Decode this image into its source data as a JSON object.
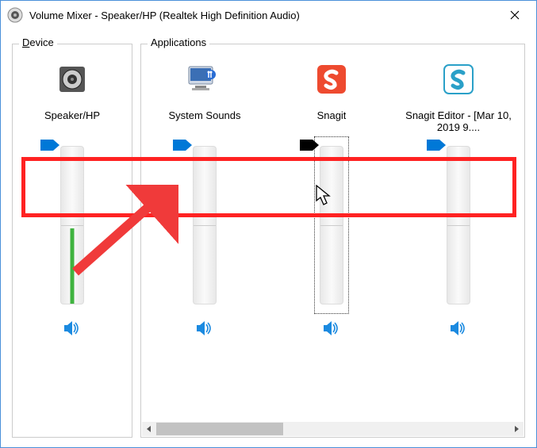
{
  "window": {
    "title": "Volume Mixer - Speaker/HP (Realtek High Definition Audio)"
  },
  "sections": {
    "device": "Device",
    "applications": "Applications"
  },
  "device": {
    "name": "Speaker/HP",
    "icon": "speaker-device-icon",
    "thumb": "blue",
    "level_pct": 48,
    "muted": false
  },
  "apps": [
    {
      "name": "System Sounds",
      "icon": "system-sounds-icon",
      "thumb": "blue",
      "focused": false,
      "muted": false
    },
    {
      "name": "Snagit",
      "icon": "snagit-icon",
      "thumb": "black",
      "focused": true,
      "muted": false
    },
    {
      "name": "Snagit Editor - [Mar 10, 2019 9....",
      "icon": "snagit-editor-icon",
      "thumb": "blue",
      "focused": false,
      "muted": false
    }
  ],
  "annotation": {
    "highlight": true,
    "arrow": true,
    "cursor": true
  }
}
